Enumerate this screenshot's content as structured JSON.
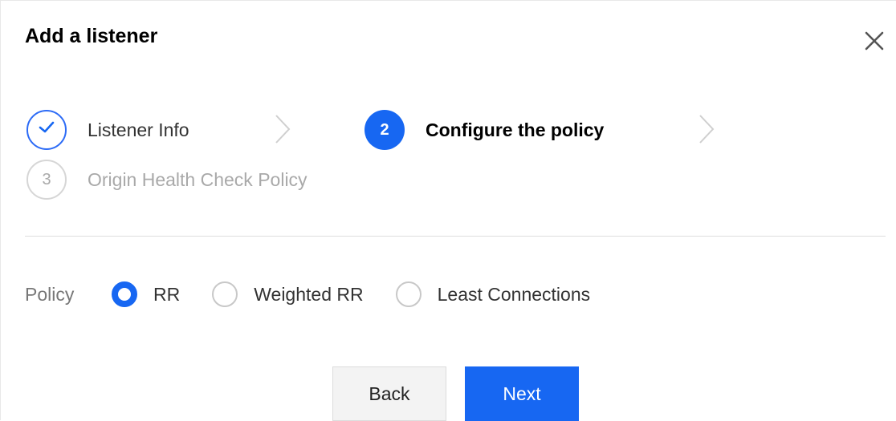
{
  "dialog": {
    "title": "Add a listener"
  },
  "steps": [
    {
      "number": "",
      "label": "Listener Info",
      "state": "done"
    },
    {
      "number": "2",
      "label": "Configure the policy",
      "state": "active"
    },
    {
      "number": "3",
      "label": "Origin Health Check Policy",
      "state": "pending"
    }
  ],
  "policy": {
    "label": "Policy",
    "options": [
      {
        "label": "RR",
        "checked": true
      },
      {
        "label": "Weighted RR",
        "checked": false
      },
      {
        "label": "Least Connections",
        "checked": false
      }
    ]
  },
  "buttons": {
    "back_label": "Back",
    "next_label": "Next"
  },
  "colors": {
    "accent": "#1767f2",
    "pending": "#a9a9a9"
  },
  "icons": {
    "close": "close-icon",
    "check": "check-icon",
    "chevron": "chevron-right-icon"
  }
}
